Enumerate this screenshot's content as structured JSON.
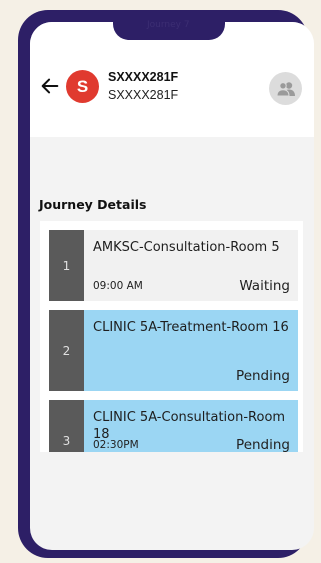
{
  "notch": {
    "label": "Journey 7"
  },
  "header": {
    "avatar_letter": "S",
    "patient_id": "SXXXX281F",
    "patient_sub": "SXXXX281F"
  },
  "journey": {
    "title": "Journey Details",
    "steps": [
      {
        "number": "1",
        "room": "AMKSC-Consultation-Room 5",
        "time": "09:00 AM",
        "status": "Waiting"
      },
      {
        "number": "2",
        "room": "CLINIC 5A-Treatment-Room 16",
        "time": "",
        "status": "Pending"
      },
      {
        "number": "3",
        "room": "CLINIC 5A-Consultation-Room 18",
        "time": "02:30PM",
        "status": "Pending"
      }
    ]
  },
  "colors": {
    "frame": "#2d1f66",
    "avatar": "#e03a2f",
    "step_number_bg": "#5a5a5a",
    "waiting_bg": "#f1f1f1",
    "pending_bg": "#9bd6f3"
  },
  "icons": {
    "back": "arrow-left-icon",
    "group": "people-group-icon"
  }
}
